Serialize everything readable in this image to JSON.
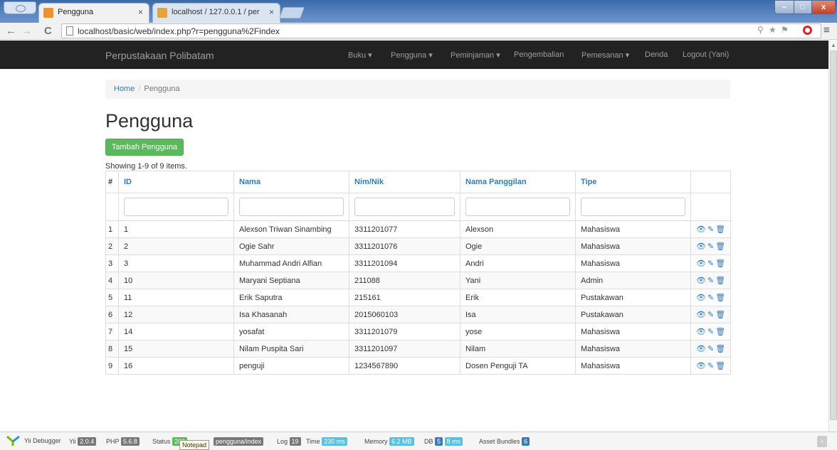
{
  "browser": {
    "tabs": [
      {
        "title": "Pengguna",
        "active": true,
        "favicon_color": "#f0922b"
      },
      {
        "title": "localhost / 127.0.0.1 / per",
        "active": false,
        "favicon_color": "#e8a23a"
      }
    ],
    "url": "localhost/basic/web/index.php?r=pengguna%2Findex",
    "close_glyph": "×"
  },
  "navbar": {
    "brand": "Perpustakaan Polibatam",
    "items": [
      {
        "label": "Buku ▾"
      },
      {
        "label": "Pengguna ▾"
      },
      {
        "label": "Peminjaman ▾"
      },
      {
        "label": "Pengembalian"
      },
      {
        "label": "Pemesanan ▾"
      },
      {
        "label": "Denda"
      },
      {
        "label": "Logout (Yani)"
      }
    ]
  },
  "breadcrumb": {
    "home": "Home",
    "separator": "/",
    "current": "Pengguna"
  },
  "page": {
    "title": "Pengguna",
    "add_button": "Tambah Pengguna",
    "summary": "Showing 1-9 of 9 items."
  },
  "table": {
    "headers": [
      "#",
      "ID",
      "Nama",
      "Nim/Nik",
      "Nama Panggilan",
      "Tipe",
      ""
    ],
    "rows": [
      {
        "n": "1",
        "id": "1",
        "nama": "Alexson Triwan Sinambing",
        "nim": "3311201077",
        "panggilan": "Alexson",
        "tipe": "Mahasiswa"
      },
      {
        "n": "2",
        "id": "2",
        "nama": "Ogie Sahr",
        "nim": "3311201076",
        "panggilan": "Ogie",
        "tipe": "Mahasiswa"
      },
      {
        "n": "3",
        "id": "3",
        "nama": "Muhammad Andri Alfian",
        "nim": "3311201094",
        "panggilan": "Andri",
        "tipe": "Mahasiswa"
      },
      {
        "n": "4",
        "id": "10",
        "nama": "Maryani Septiana",
        "nim": "211088",
        "panggilan": "Yani",
        "tipe": "Admin"
      },
      {
        "n": "5",
        "id": "11",
        "nama": "Erik Saputra",
        "nim": "215161",
        "panggilan": "Erik",
        "tipe": "Pustakawan"
      },
      {
        "n": "6",
        "id": "12",
        "nama": "Isa Khasanah",
        "nim": "2015060103",
        "panggilan": "Isa",
        "tipe": "Pustakawan"
      },
      {
        "n": "7",
        "id": "14",
        "nama": "yosafat",
        "nim": "3311201079",
        "panggilan": "yose",
        "tipe": "Mahasiswa"
      },
      {
        "n": "8",
        "id": "15",
        "nama": "Nilam Puspita Sari",
        "nim": "3311201097",
        "panggilan": "Nilam",
        "tipe": "Mahasiswa"
      },
      {
        "n": "9",
        "id": "16",
        "nama": "penguji",
        "nim": "1234567890",
        "panggilan": "Dosen Penguji TA",
        "tipe": "Mahasiswa"
      }
    ],
    "actions_glyph": "👁✎🗑"
  },
  "debugbar": {
    "title": "Yii Debugger",
    "yii_label": "Yii",
    "yii_version": "2.0.4",
    "php_label": "PHP",
    "php_version": "5.6.8",
    "status_label": "Status",
    "status_value": "200",
    "route": "pengguna/index",
    "log_label": "Log",
    "log_value": "19",
    "time_label": "Time",
    "time_value": "230 ms",
    "memory_label": "Memory",
    "memory_value": "6.2 MB",
    "db_label": "DB",
    "db_queries": "5",
    "db_time": "8 ms",
    "asset_label": "Asset Bundles",
    "asset_value": "6",
    "tooltip": "Notepad"
  },
  "colors": {
    "navbar": "#222222",
    "success": "#5cb85c",
    "link": "#337ab7"
  }
}
